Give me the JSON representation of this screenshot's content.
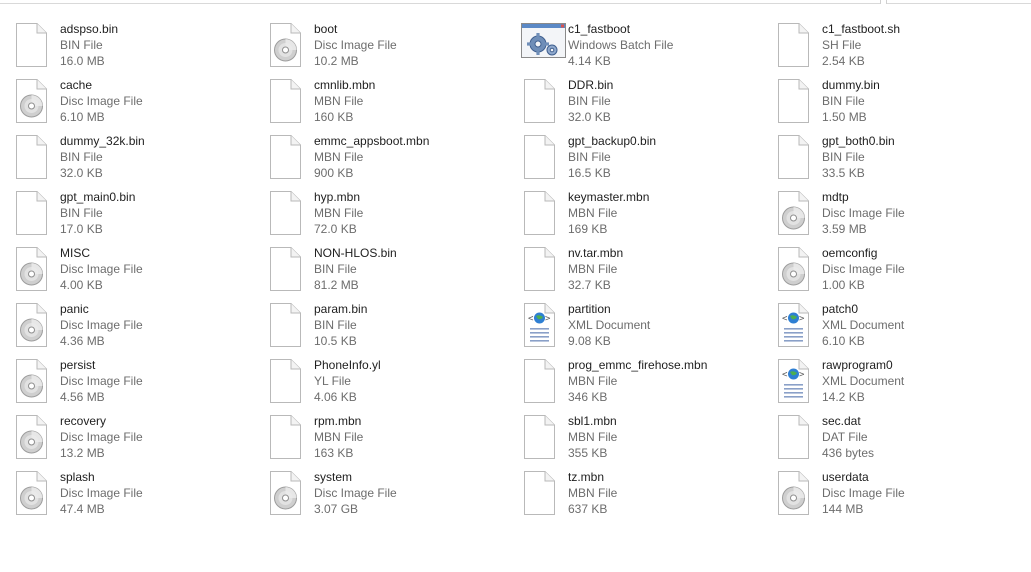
{
  "files": [
    {
      "name": "adspso.bin",
      "type": "BIN File",
      "size": "16.0 MB",
      "icon": "blank-file-icon"
    },
    {
      "name": "boot",
      "type": "Disc Image File",
      "size": "10.2 MB",
      "icon": "disc-image-icon"
    },
    {
      "name": "c1_fastboot",
      "type": "Windows Batch File",
      "size": "4.14 KB",
      "icon": "batch-file-icon"
    },
    {
      "name": "c1_fastboot.sh",
      "type": "SH File",
      "size": "2.54 KB",
      "icon": "blank-file-icon"
    },
    {
      "name": "cache",
      "type": "Disc Image File",
      "size": "6.10 MB",
      "icon": "disc-image-icon"
    },
    {
      "name": "cmnlib.mbn",
      "type": "MBN File",
      "size": "160 KB",
      "icon": "blank-file-icon"
    },
    {
      "name": "DDR.bin",
      "type": "BIN File",
      "size": "32.0 KB",
      "icon": "blank-file-icon"
    },
    {
      "name": "dummy.bin",
      "type": "BIN File",
      "size": "1.50 MB",
      "icon": "blank-file-icon"
    },
    {
      "name": "dummy_32k.bin",
      "type": "BIN File",
      "size": "32.0 KB",
      "icon": "blank-file-icon"
    },
    {
      "name": "emmc_appsboot.mbn",
      "type": "MBN File",
      "size": "900 KB",
      "icon": "blank-file-icon"
    },
    {
      "name": "gpt_backup0.bin",
      "type": "BIN File",
      "size": "16.5 KB",
      "icon": "blank-file-icon"
    },
    {
      "name": "gpt_both0.bin",
      "type": "BIN File",
      "size": "33.5 KB",
      "icon": "blank-file-icon"
    },
    {
      "name": "gpt_main0.bin",
      "type": "BIN File",
      "size": "17.0 KB",
      "icon": "blank-file-icon"
    },
    {
      "name": "hyp.mbn",
      "type": "MBN File",
      "size": "72.0 KB",
      "icon": "blank-file-icon"
    },
    {
      "name": "keymaster.mbn",
      "type": "MBN File",
      "size": "169 KB",
      "icon": "blank-file-icon"
    },
    {
      "name": "mdtp",
      "type": "Disc Image File",
      "size": "3.59 MB",
      "icon": "disc-image-icon"
    },
    {
      "name": "MISC",
      "type": "Disc Image File",
      "size": "4.00 KB",
      "icon": "disc-image-icon"
    },
    {
      "name": "NON-HLOS.bin",
      "type": "BIN File",
      "size": "81.2 MB",
      "icon": "blank-file-icon"
    },
    {
      "name": "nv.tar.mbn",
      "type": "MBN File",
      "size": "32.7 KB",
      "icon": "blank-file-icon"
    },
    {
      "name": "oemconfig",
      "type": "Disc Image File",
      "size": "1.00 KB",
      "icon": "disc-image-icon"
    },
    {
      "name": "panic",
      "type": "Disc Image File",
      "size": "4.36 MB",
      "icon": "disc-image-icon"
    },
    {
      "name": "param.bin",
      "type": "BIN File",
      "size": "10.5 KB",
      "icon": "blank-file-icon"
    },
    {
      "name": "partition",
      "type": "XML Document",
      "size": "9.08 KB",
      "icon": "xml-document-icon"
    },
    {
      "name": "patch0",
      "type": "XML Document",
      "size": "6.10 KB",
      "icon": "xml-document-icon"
    },
    {
      "name": "persist",
      "type": "Disc Image File",
      "size": "4.56 MB",
      "icon": "disc-image-icon"
    },
    {
      "name": "PhoneInfo.yl",
      "type": "YL File",
      "size": "4.06 KB",
      "icon": "blank-file-icon"
    },
    {
      "name": "prog_emmc_firehose.mbn",
      "type": "MBN File",
      "size": "346 KB",
      "icon": "blank-file-icon"
    },
    {
      "name": "rawprogram0",
      "type": "XML Document",
      "size": "14.2 KB",
      "icon": "xml-document-icon"
    },
    {
      "name": "recovery",
      "type": "Disc Image File",
      "size": "13.2 MB",
      "icon": "disc-image-icon"
    },
    {
      "name": "rpm.mbn",
      "type": "MBN File",
      "size": "163 KB",
      "icon": "blank-file-icon"
    },
    {
      "name": "sbl1.mbn",
      "type": "MBN File",
      "size": "355 KB",
      "icon": "blank-file-icon"
    },
    {
      "name": "sec.dat",
      "type": "DAT File",
      "size": "436 bytes",
      "icon": "blank-file-icon"
    },
    {
      "name": "splash",
      "type": "Disc Image File",
      "size": "47.4 MB",
      "icon": "disc-image-icon"
    },
    {
      "name": "system",
      "type": "Disc Image File",
      "size": "3.07 GB",
      "icon": "disc-image-icon"
    },
    {
      "name": "tz.mbn",
      "type": "MBN File",
      "size": "637 KB",
      "icon": "blank-file-icon"
    },
    {
      "name": "userdata",
      "type": "Disc Image File",
      "size": "144 MB",
      "icon": "disc-image-icon"
    }
  ]
}
